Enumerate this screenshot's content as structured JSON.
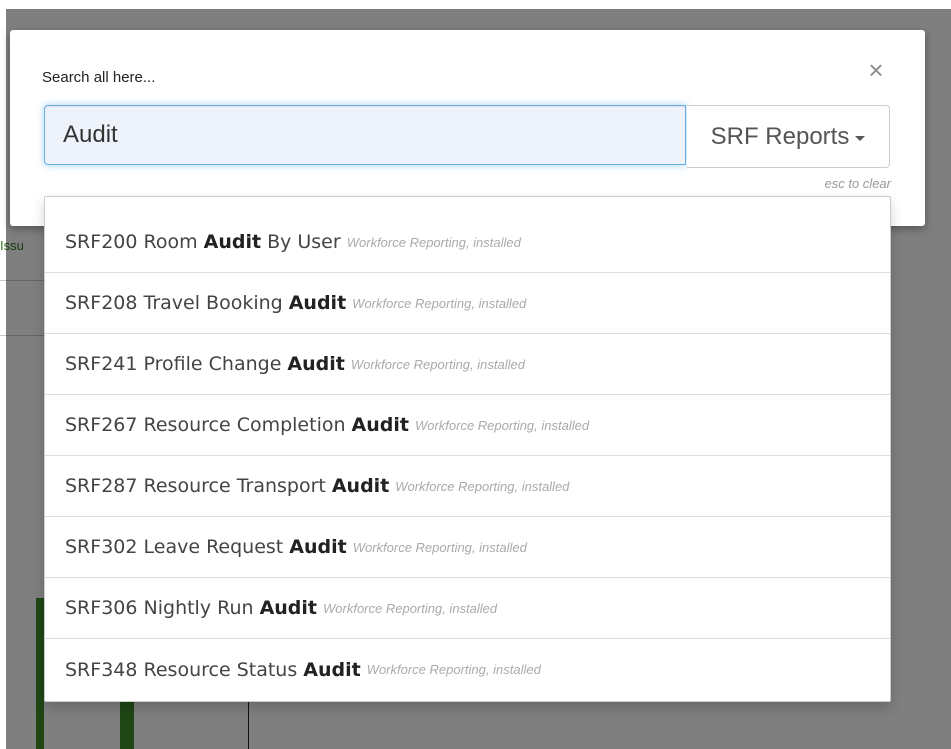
{
  "background": {
    "issues_fragment": "Issu"
  },
  "modal": {
    "title": "Search all here...",
    "close_glyph": "×",
    "search_value": "Audit",
    "scope_label": "SRF Reports",
    "esc_hint": "esc to clear"
  },
  "results": [
    {
      "code": "SRF200",
      "pre": "Room",
      "match": "Audit",
      "post": "By User",
      "meta": "Workforce Reporting, installed"
    },
    {
      "code": "SRF208",
      "pre": "Travel Booking",
      "match": "Audit",
      "post": "",
      "meta": "Workforce Reporting, installed"
    },
    {
      "code": "SRF241",
      "pre": "Profile Change",
      "match": "Audit",
      "post": "",
      "meta": "Workforce Reporting, installed"
    },
    {
      "code": "SRF267",
      "pre": "Resource Completion",
      "match": "Audit",
      "post": "",
      "meta": "Workforce Reporting, installed"
    },
    {
      "code": "SRF287",
      "pre": "Resource Transport",
      "match": "Audit",
      "post": "",
      "meta": "Workforce Reporting, installed"
    },
    {
      "code": "SRF302",
      "pre": "Leave Request",
      "match": "Audit",
      "post": "",
      "meta": "Workforce Reporting, installed"
    },
    {
      "code": "SRF306",
      "pre": "Nightly Run",
      "match": "Audit",
      "post": "",
      "meta": "Workforce Reporting, installed"
    },
    {
      "code": "SRF348",
      "pre": "Resource Status",
      "match": "Audit",
      "post": "",
      "meta": "Workforce Reporting, installed"
    }
  ],
  "colors": {
    "overlay": "#808080",
    "bar_green": "#3f8f2a",
    "input_focus": "#66afe9"
  }
}
